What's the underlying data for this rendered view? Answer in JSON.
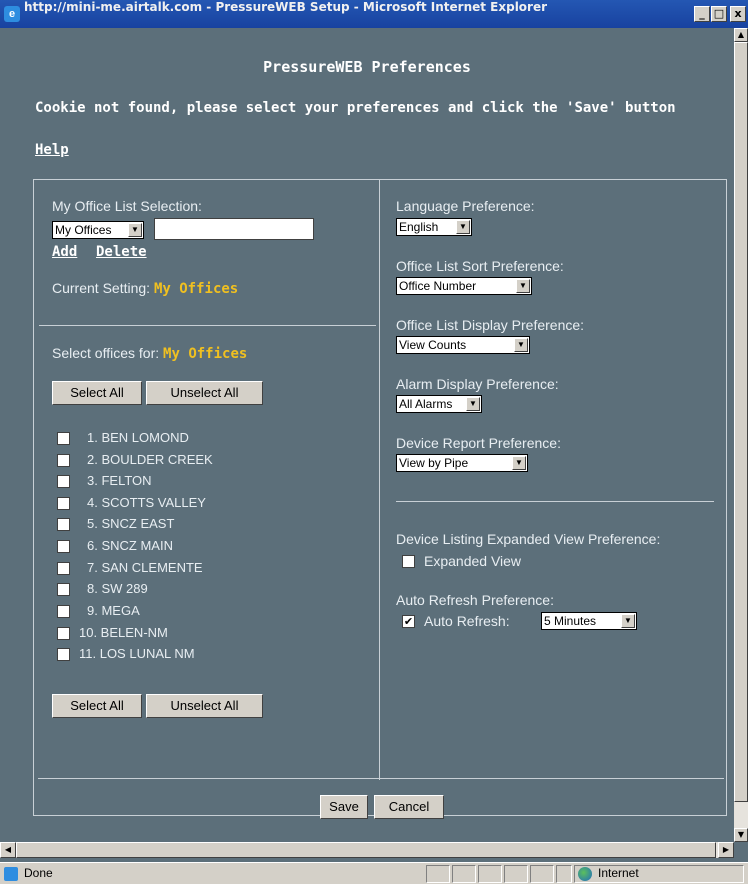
{
  "window": {
    "title": "http://mini-me.airtalk.com - PressureWEB Setup - Microsoft Internet Explorer",
    "minimize": "_",
    "maximize": "□",
    "close": "x"
  },
  "page": {
    "title": "PressureWEB Preferences",
    "message": "Cookie not found, please select your preferences and click the 'Save' button",
    "help_link": "Help"
  },
  "office_list": {
    "label": "My Office List Selection:",
    "selected": "My Offices",
    "textbox_value": "",
    "add_link": "Add",
    "delete_link": "Delete",
    "current_setting_label": "Current Setting:",
    "current_setting_value": "My Offices"
  },
  "select_offices": {
    "label": "Select offices for:",
    "value": "My Offices",
    "select_all": "Select All",
    "unselect_all": "Unselect All",
    "offices": [
      {
        "label": "1. BEN LOMOND",
        "checked": false
      },
      {
        "label": "2. BOULDER CREEK",
        "checked": false
      },
      {
        "label": "3. FELTON",
        "checked": false
      },
      {
        "label": "4. SCOTTS VALLEY",
        "checked": false
      },
      {
        "label": "5. SNCZ EAST",
        "checked": false
      },
      {
        "label": "6. SNCZ MAIN",
        "checked": false
      },
      {
        "label": "7. SAN CLEMENTE",
        "checked": false
      },
      {
        "label": "8. SW 289",
        "checked": false
      },
      {
        "label": "9. MEGA",
        "checked": false
      },
      {
        "label": "10. BELEN-NM",
        "checked": false
      },
      {
        "label": "11. LOS LUNAL NM",
        "checked": false
      }
    ]
  },
  "preferences": {
    "language": {
      "label": "Language Preference:",
      "value": "English"
    },
    "sort": {
      "label": "Office List Sort Preference:",
      "value": "Office Number"
    },
    "display": {
      "label": "Office List Display Preference:",
      "value": "View Counts"
    },
    "alarm": {
      "label": "Alarm Display Preference:",
      "value": "All Alarms"
    },
    "device_report": {
      "label": "Device Report Preference:",
      "value": "View by Pipe"
    },
    "expanded": {
      "label": "Device Listing Expanded View Preference:",
      "checkbox_label": "Expanded View",
      "checked": false
    },
    "refresh": {
      "label": "Auto Refresh Preference:",
      "checkbox_label": "Auto Refresh:",
      "checked": true,
      "value": "5 Minutes"
    }
  },
  "actions": {
    "save": "Save",
    "cancel": "Cancel"
  },
  "status": {
    "text": "Done",
    "zone": "Internet"
  },
  "colors": {
    "background": "#5c6f7a",
    "highlight": "#f0c020",
    "titlebar": "#2457b3"
  }
}
